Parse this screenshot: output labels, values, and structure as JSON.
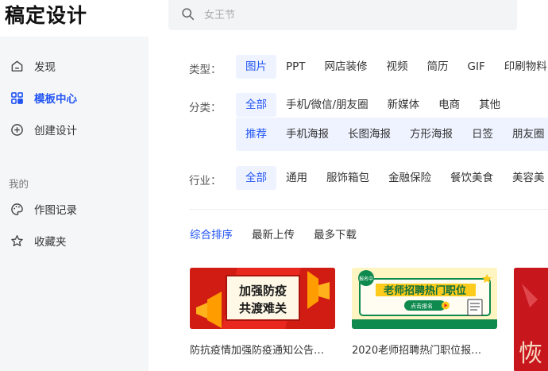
{
  "app": {
    "logo": "稿定设计"
  },
  "search": {
    "placeholder": "女王节"
  },
  "sidebar": {
    "items": [
      {
        "label": "发现"
      },
      {
        "label": "模板中心"
      },
      {
        "label": "创建设计"
      }
    ],
    "section_mine": "我的",
    "mine_items": [
      {
        "label": "作图记录"
      },
      {
        "label": "收藏夹"
      }
    ]
  },
  "filters": {
    "type": {
      "label": "类型：",
      "options": [
        "图片",
        "PPT",
        "网店装修",
        "视频",
        "简历",
        "GIF",
        "印刷物料"
      ],
      "selected": "图片"
    },
    "category": {
      "label": "分类：",
      "options": [
        "全部",
        "手机/微信/朋友圈",
        "新媒体",
        "电商",
        "其他"
      ],
      "selected": "全部",
      "sub_options": [
        "推荐",
        "手机海报",
        "长图海报",
        "方形海报",
        "日签",
        "朋友圈"
      ],
      "sub_selected": "推荐"
    },
    "industry": {
      "label": "行业：",
      "options": [
        "全部",
        "通用",
        "服饰箱包",
        "金融保险",
        "餐饮美食",
        "美容美"
      ],
      "selected": "全部"
    }
  },
  "sort": {
    "options": [
      "综合排序",
      "最新上传",
      "最多下载"
    ],
    "selected": "综合排序"
  },
  "templates": [
    {
      "title": "防抗疫情加强防疫通知公告…",
      "thumb_line1": "加强防疫",
      "thumb_line2": "共渡难关"
    },
    {
      "title": "2020老师招聘热门职位报…",
      "thumb_text": "老师招聘热门职位",
      "thumb_button": "点击报名",
      "thumb_badge": "报名中"
    },
    {
      "title": "",
      "thumb_glyph": "恢"
    }
  ],
  "colors": {
    "accent": "#2254f4",
    "sidebar_bg": "#f5f6f8",
    "chip_active_bg": "#eef3ff",
    "card1_red": "#e8281f",
    "card2_green": "#0f8a4f",
    "card2_yellow": "#fccb1c"
  }
}
